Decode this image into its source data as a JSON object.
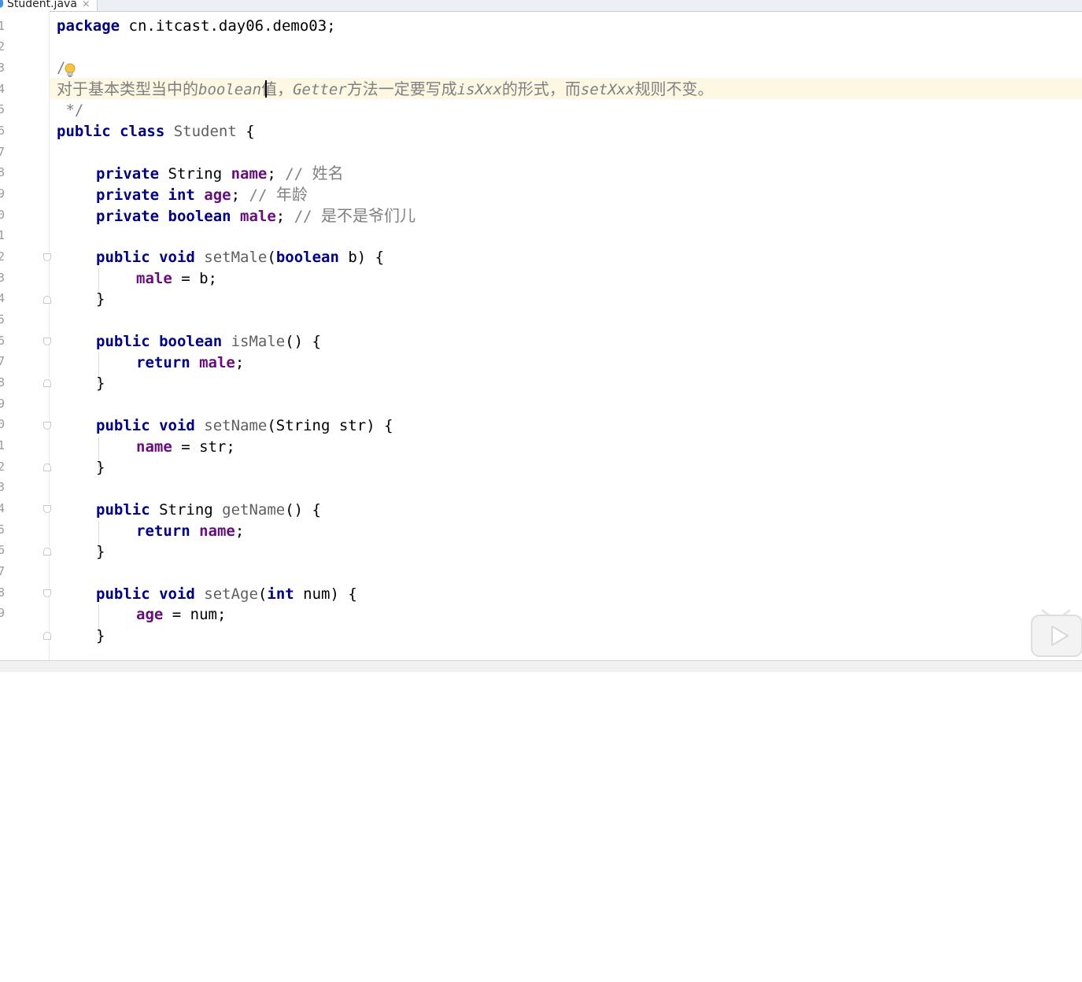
{
  "tab": {
    "filename": "Student.java",
    "close": "×"
  },
  "line_numbers": [
    "1",
    "2",
    "3",
    "4",
    "5",
    "6",
    "7",
    "8",
    "9",
    "0",
    "1",
    "2",
    "3",
    "4",
    "5",
    "6",
    "7",
    "8",
    "9",
    "0",
    "1",
    "2",
    "3",
    "4",
    "5",
    "6",
    "7",
    "8",
    "9"
  ],
  "code": {
    "l1_kw": "package",
    "l1_rest": " cn.itcast.day06.demo03;",
    "l3": "/",
    "l4_a": "对于基本类型当中的",
    "l4_b": "boolean",
    "l4_c": "值，",
    "l4_d": "Getter",
    "l4_e": "方法一定要写成",
    "l4_f": "isXxx",
    "l4_g": "的形式，而",
    "l4_h": "setXxx",
    "l4_i": "规则不变。",
    "l5": " */",
    "l6_kw": "public class",
    "l6_name": " Student",
    "l6_rest": " {",
    "l8_kw": "private",
    "l8_type": " String ",
    "l8_field": "name",
    "l8_semi": "; ",
    "l8_cm": "// ",
    "l8_cn": "姓名",
    "l9_kw": "private int",
    "l9_field": " age",
    "l9_semi": "; ",
    "l9_cm": "// ",
    "l9_cn": "年龄",
    "l10_kw": "private boolean",
    "l10_field": " male",
    "l10_semi": "; ",
    "l10_cm": "// ",
    "l10_cn": "是不是爷们儿",
    "l12_kw": "public void",
    "l12_m": " setMale",
    "l12_p1": "(",
    "l12_pk": "boolean",
    "l12_p2": " b) {",
    "l13_f": "male",
    "l13_r": " = b;",
    "brace": "}",
    "l16_kw": "public boolean",
    "l16_m": " isMale",
    "l16_r": "() {",
    "ret": "return",
    "l17_f": " male",
    "semi": ";",
    "l20_kw": "public void",
    "l20_m": " setName",
    "l20_r": "(String str) {",
    "l21_f": "name",
    "l21_r": " = str;",
    "l24_kw": "public",
    "l24_t": " String",
    "l24_m": " getName",
    "l24_r": "() {",
    "l25_f": " name",
    "l28_kw": "public void",
    "l28_m": " setAge",
    "l28_p1": "(",
    "l28_pk": "int",
    "l28_p2": " num) {",
    "l29_f": "age",
    "l29_r": " = num;"
  },
  "icons": {
    "bulb": "lightbulb-icon",
    "play": "play-icon",
    "file": "java-file-icon"
  },
  "colors": {
    "keyword": "#000080",
    "field": "#660e7a",
    "comment": "#808080",
    "highlight": "#fdf8e4"
  }
}
